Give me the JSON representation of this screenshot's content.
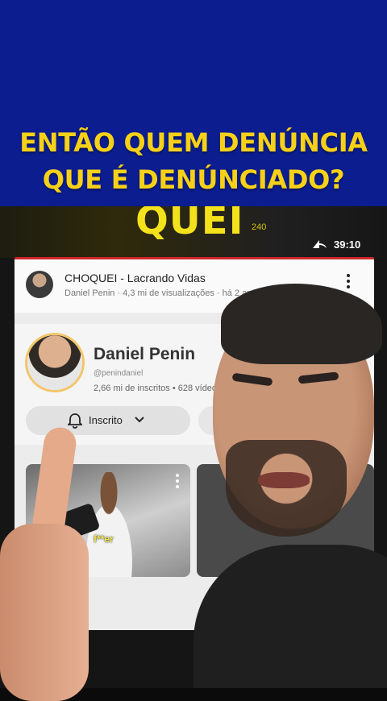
{
  "caption": {
    "line1": "ENTÃO QUEM DENÚNCIA",
    "line2": "QUE É DENÚNCIADO?"
  },
  "video": {
    "thumbnail_text": "QUEI",
    "thumbnail_number": "240",
    "duration": "39:10",
    "title": "CHOQUEI - Lacrando Vidas",
    "meta": "Daniel Penin · 4,3 mi de visualizações · há 2 anos"
  },
  "channel": {
    "name": "Daniel Penin",
    "handle": "@penindaniel",
    "stats": "2,66 mi de inscritos • 628 vídeos",
    "subscribe_label": "Inscrito"
  },
  "short_caption": "f**er",
  "colors": {
    "banner": "#0b1d8f",
    "caption": "#f7d117",
    "accent_red": "#d0262b"
  },
  "icons": [
    "share-icon",
    "kebab-menu-icon",
    "bell-icon",
    "chevron-down-icon"
  ]
}
